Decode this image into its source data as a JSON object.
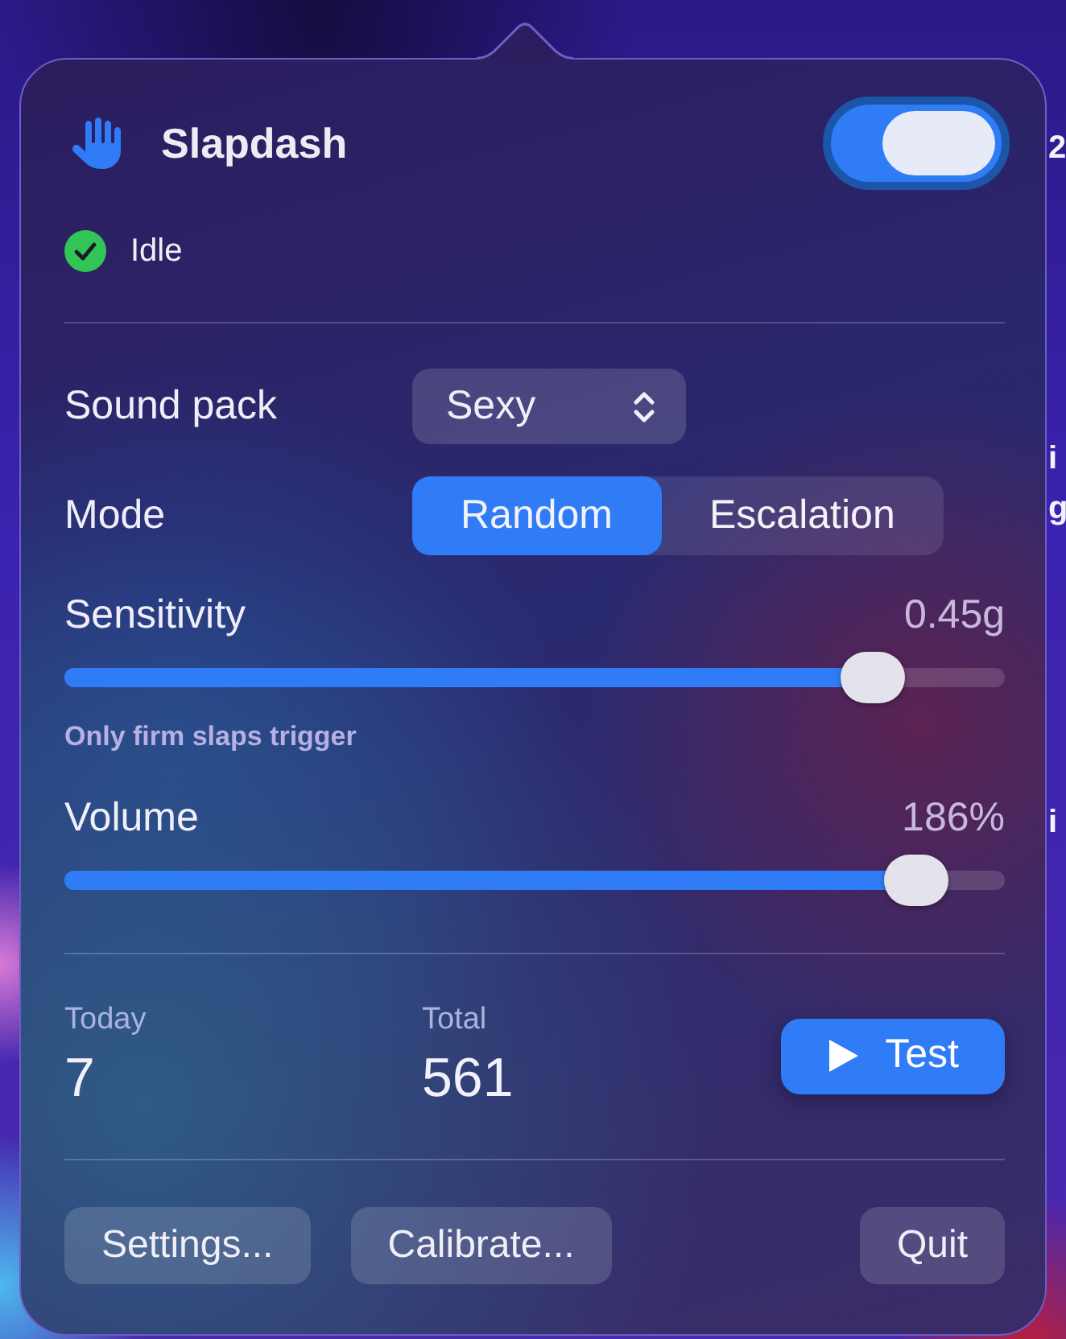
{
  "desktop": {
    "text_fragments": [
      "2",
      "i",
      "g",
      "i"
    ]
  },
  "header": {
    "title": "Slapdash",
    "enabled": true
  },
  "status": {
    "label": "Idle"
  },
  "controls": [
    {
      "kind": "popup",
      "label": "Sound pack",
      "value": "Sexy"
    },
    {
      "kind": "segmented",
      "label": "Mode",
      "options": [
        {
          "label": "Random",
          "selected": true
        },
        {
          "label": "Escalation",
          "selected": false
        }
      ]
    }
  ],
  "sliders": [
    {
      "label": "Sensitivity",
      "reading": "0.45g",
      "level": 0.86,
      "hint": "Only firm slaps trigger"
    },
    {
      "label": "Volume",
      "reading": "186%",
      "level": 0.905
    }
  ],
  "stats": [
    {
      "label": "Today",
      "value": "7"
    },
    {
      "label": "Total",
      "value": "561"
    }
  ],
  "test_button": {
    "label": "Test"
  },
  "footer_buttons": [
    {
      "label": "Settings..."
    },
    {
      "label": "Calibrate..."
    },
    {
      "label": "Quit"
    }
  ]
}
